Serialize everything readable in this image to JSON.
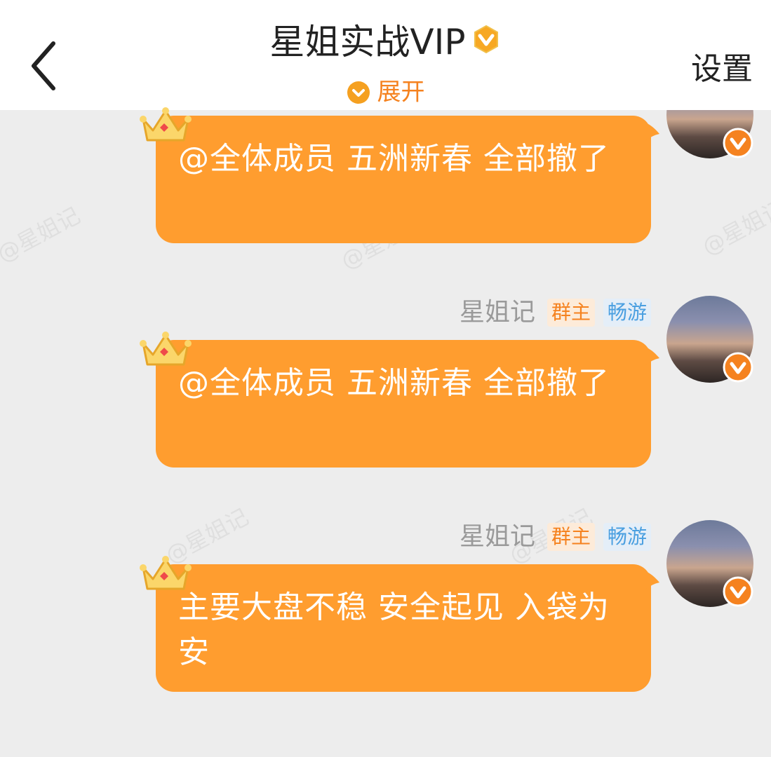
{
  "header": {
    "title": "星姐实战VIP",
    "expand_label": "展开",
    "settings_label": "设置"
  },
  "watermark_text": "@星姐记",
  "colors": {
    "accent": "#f5821f",
    "bubble": "#ff9d2f",
    "background": "#ededed"
  },
  "messages": [
    {
      "text": "@全体成员 五洲新春  全部撤了"
    },
    {
      "sender": "星姐记",
      "owner_tag": "群主",
      "level_tag": "畅游",
      "text": "@全体成员 五洲新春  全部撤了"
    },
    {
      "sender": "星姐记",
      "owner_tag": "群主",
      "level_tag": "畅游",
      "text": "主要大盘不稳  安全起见  入袋为安"
    }
  ]
}
